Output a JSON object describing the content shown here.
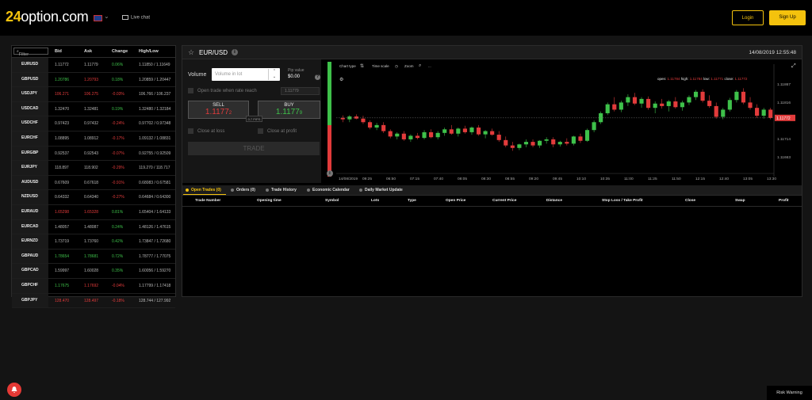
{
  "header": {
    "logo_prefix": "24",
    "logo_suffix": "option.com",
    "live_chat": "Live chat",
    "login": "Login",
    "signup": "Sign Up"
  },
  "instruments": {
    "filter_placeholder": "Filter",
    "columns": [
      "Bid",
      "Ask",
      "Change",
      "High/Low"
    ],
    "rows": [
      {
        "symbol": "EURUSD",
        "bid": "1.11772",
        "ask": "1.11779",
        "change": "0.06%",
        "highlow": "1.11850 / 1.11649",
        "bid_dir": "nt",
        "ask_dir": "nt",
        "chg_dir": "up"
      },
      {
        "symbol": "GBPUSD",
        "bid": "1.20786",
        "ask": "1.20793",
        "change": "0.18%",
        "highlow": "1.20859 / 1.20447",
        "bid_dir": "up",
        "ask_dir": "dn",
        "chg_dir": "up"
      },
      {
        "symbol": "USDJPY",
        "bid": "106.271",
        "ask": "106.275",
        "change": "-0.03%",
        "highlow": "106.766 / 106.237",
        "bid_dir": "dn",
        "ask_dir": "dn",
        "chg_dir": "dn"
      },
      {
        "symbol": "USDCAD",
        "bid": "1.32470",
        "ask": "1.32481",
        "change": "0.19%",
        "highlow": "1.32480 / 1.32184",
        "bid_dir": "nt",
        "ask_dir": "nt",
        "chg_dir": "up"
      },
      {
        "symbol": "USDCHF",
        "bid": "0.97423",
        "ask": "0.97432",
        "change": "-0.24%",
        "highlow": "0.97702 / 0.97348",
        "bid_dir": "nt",
        "ask_dir": "nt",
        "chg_dir": "dn"
      },
      {
        "symbol": "EURCHF",
        "bid": "1.08895",
        "ask": "1.08912",
        "change": "-0.17%",
        "highlow": "1.09132 / 1.08831",
        "bid_dir": "nt",
        "ask_dir": "nt",
        "chg_dir": "dn"
      },
      {
        "symbol": "EURGBP",
        "bid": "0.92537",
        "ask": "0.92543",
        "change": "-0.07%",
        "highlow": "0.92755 / 0.92509",
        "bid_dir": "nt",
        "ask_dir": "nt",
        "chg_dir": "dn"
      },
      {
        "symbol": "EURJPY",
        "bid": "118.897",
        "ask": "118.902",
        "change": "-0.29%",
        "highlow": "119.270 / 118.717",
        "bid_dir": "nt",
        "ask_dir": "nt",
        "chg_dir": "dn"
      },
      {
        "symbol": "AUDUSD",
        "bid": "0.67609",
        "ask": "0.67618",
        "change": "-0.91%",
        "highlow": "0.68083 / 0.67581",
        "bid_dir": "nt",
        "ask_dir": "nt",
        "chg_dir": "dn"
      },
      {
        "symbol": "NZDUSD",
        "bid": "0.64332",
        "ask": "0.64340",
        "change": "-0.27%",
        "highlow": "0.64684 / 0.64300",
        "bid_dir": "nt",
        "ask_dir": "nt",
        "chg_dir": "dn"
      },
      {
        "symbol": "EURAUD",
        "bid": "1.65298",
        "ask": "1.65328",
        "change": "0.81%",
        "highlow": "1.65404 / 1.64133",
        "bid_dir": "dn",
        "ask_dir": "dn",
        "chg_dir": "up"
      },
      {
        "symbol": "EURCAD",
        "bid": "1.48057",
        "ask": "1.48087",
        "change": "0.24%",
        "highlow": "1.48126 / 1.47615",
        "bid_dir": "nt",
        "ask_dir": "nt",
        "chg_dir": "up"
      },
      {
        "symbol": "EURNZD",
        "bid": "1.73719",
        "ask": "1.73760",
        "change": "0.42%",
        "highlow": "1.73847 / 1.72680",
        "bid_dir": "nt",
        "ask_dir": "nt",
        "chg_dir": "up"
      },
      {
        "symbol": "GBPAUD",
        "bid": "1.78654",
        "ask": "1.78681",
        "change": "0.72%",
        "highlow": "1.78777 / 1.77075",
        "bid_dir": "up",
        "ask_dir": "up",
        "chg_dir": "up"
      },
      {
        "symbol": "GBPCAD",
        "bid": "1.59997",
        "ask": "1.60028",
        "change": "0.35%",
        "highlow": "1.60056 / 1.59270",
        "bid_dir": "nt",
        "ask_dir": "nt",
        "chg_dir": "up"
      },
      {
        "symbol": "GBPCHF",
        "bid": "1.17675",
        "ask": "1.17692",
        "change": "-0.04%",
        "highlow": "1.17799 / 1.17418",
        "bid_dir": "up",
        "ask_dir": "dn",
        "chg_dir": "dn"
      },
      {
        "symbol": "GBPJPY",
        "bid": "128.470",
        "ask": "128.497",
        "change": "-0.18%",
        "highlow": "128.744 / 127.992",
        "bid_dir": "dn",
        "ask_dir": "dn",
        "chg_dir": "dn"
      }
    ]
  },
  "panel": {
    "symbol": "EUR/USD",
    "datetime": "14/08/2019 12:55:48",
    "volume_label": "Volume",
    "volume_placeholder": "Volume in lot",
    "pip_label": "Pip value",
    "pip_value": "$0.00",
    "open_trade_label": "Open trade when rate reach",
    "rate_value": "1.11779",
    "sell_label": "SELL",
    "sell_price": "1.1177",
    "sell_sub": "2",
    "buy_label": "BUY",
    "buy_price": "1.1177",
    "buy_sub": "9",
    "pips": "0.7 PIPS",
    "close_loss": "Close at loss",
    "close_profit": "Close at profit",
    "trade_button": "TRADE",
    "sentiment_buy": 0.55
  },
  "chart_toolbar": {
    "chart_type": "Chart type",
    "time_scale": "Time scale",
    "zoom": "Zoom",
    "more": "..."
  },
  "chart_data": {
    "type": "candlestick",
    "ohlc_labels": {
      "open": "open:",
      "high": "high:",
      "low": "low:",
      "close": "close:"
    },
    "ohlc_values": {
      "open": "1.11784",
      "high": "1.11784",
      "low": "1.11771",
      "close": "1.11772"
    },
    "current_price": "1.11772",
    "y_ticks": [
      "1.11867",
      "1.11816",
      "1.11714",
      "1.11663"
    ],
    "y_tick_values": [
      1.11867,
      1.11816,
      1.11714,
      1.11663
    ],
    "x_ticks": [
      "14/08/2019",
      "09:25",
      "06:50",
      "07:15",
      "07:40",
      "08:05",
      "08:30",
      "08:55",
      "09:20",
      "09:45",
      "10:10",
      "10:35",
      "11:00",
      "11:25",
      "11:50",
      "12:15",
      "12:40",
      "13:05",
      "13:30"
    ],
    "ylim": [
      1.1163,
      1.119
    ],
    "candles": [
      [
        1.11772,
        1.11779,
        1.1176,
        1.11768
      ],
      [
        1.11768,
        1.1178,
        1.1176,
        1.11776
      ],
      [
        1.11776,
        1.11782,
        1.11768,
        1.1177
      ],
      [
        1.1177,
        1.11778,
        1.11755,
        1.1176
      ],
      [
        1.1176,
        1.11765,
        1.1174,
        1.11745
      ],
      [
        1.11745,
        1.11758,
        1.11738,
        1.11752
      ],
      [
        1.11752,
        1.1176,
        1.1173,
        1.11735
      ],
      [
        1.11735,
        1.1174,
        1.11715,
        1.1172
      ],
      [
        1.1172,
        1.11732,
        1.11712,
        1.11728
      ],
      [
        1.11728,
        1.11735,
        1.11708,
        1.11712
      ],
      [
        1.11712,
        1.11726,
        1.11705,
        1.11722
      ],
      [
        1.11722,
        1.1173,
        1.11712,
        1.11716
      ],
      [
        1.11716,
        1.11738,
        1.11712,
        1.11732
      ],
      [
        1.11732,
        1.1174,
        1.11715,
        1.11718
      ],
      [
        1.11718,
        1.11735,
        1.11712,
        1.1173
      ],
      [
        1.1173,
        1.11745,
        1.11722,
        1.1174
      ],
      [
        1.1174,
        1.11752,
        1.11725,
        1.11728
      ],
      [
        1.11728,
        1.11745,
        1.1172,
        1.11742
      ],
      [
        1.11742,
        1.1175,
        1.11728,
        1.11732
      ],
      [
        1.11732,
        1.11748,
        1.11725,
        1.11745
      ],
      [
        1.11745,
        1.11752,
        1.11722,
        1.11726
      ],
      [
        1.11726,
        1.11738,
        1.11715,
        1.11735
      ],
      [
        1.11735,
        1.11742,
        1.11722,
        1.11725
      ],
      [
        1.11725,
        1.11735,
        1.11705,
        1.1171
      ],
      [
        1.1171,
        1.1172,
        1.1169,
        1.11695
      ],
      [
        1.11695,
        1.11705,
        1.1168,
        1.11688
      ],
      [
        1.11688,
        1.117,
        1.11682,
        1.11698
      ],
      [
        1.11698,
        1.11712,
        1.1169,
        1.11705
      ],
      [
        1.11705,
        1.11712,
        1.1169,
        1.11695
      ],
      [
        1.11695,
        1.1171,
        1.11688,
        1.11708
      ],
      [
        1.11708,
        1.11718,
        1.117,
        1.11712
      ],
      [
        1.11712,
        1.11718,
        1.1169,
        1.11698
      ],
      [
        1.11698,
        1.11708,
        1.11692,
        1.11705
      ],
      [
        1.11705,
        1.11715,
        1.11695,
        1.117
      ],
      [
        1.117,
        1.11722,
        1.11695,
        1.1172
      ],
      [
        1.1172,
        1.11728,
        1.11702,
        1.11708
      ],
      [
        1.11708,
        1.11742,
        1.11705,
        1.11738
      ],
      [
        1.11738,
        1.11765,
        1.11732,
        1.1176
      ],
      [
        1.1176,
        1.1179,
        1.11755,
        1.11785
      ],
      [
        1.11785,
        1.11815,
        1.1178,
        1.1181
      ],
      [
        1.1181,
        1.1183,
        1.1179,
        1.11795
      ],
      [
        1.11795,
        1.1182,
        1.11788,
        1.11815
      ],
      [
        1.11815,
        1.11838,
        1.11805,
        1.1183
      ],
      [
        1.1183,
        1.11842,
        1.11808,
        1.11812
      ],
      [
        1.11812,
        1.1183,
        1.118,
        1.11825
      ],
      [
        1.11825,
        1.11832,
        1.11795,
        1.118
      ],
      [
        1.118,
        1.11818,
        1.11785,
        1.11812
      ],
      [
        1.11812,
        1.11825,
        1.11798,
        1.11805
      ],
      [
        1.11805,
        1.11822,
        1.1179,
        1.11818
      ],
      [
        1.11818,
        1.1183,
        1.11798,
        1.11802
      ],
      [
        1.11802,
        1.1182,
        1.11792,
        1.11815
      ],
      [
        1.11815,
        1.11835,
        1.11808,
        1.1183
      ],
      [
        1.1183,
        1.1185,
        1.11822,
        1.11845
      ],
      [
        1.11845,
        1.11852,
        1.11815,
        1.1182
      ],
      [
        1.1182,
        1.11835,
        1.118,
        1.11805
      ],
      [
        1.11805,
        1.11815,
        1.1177,
        1.11775
      ],
      [
        1.11775,
        1.118,
        1.11768,
        1.11795
      ],
      [
        1.11795,
        1.11828,
        1.1179,
        1.11822
      ],
      [
        1.11822,
        1.1185,
        1.11815,
        1.11845
      ],
      [
        1.11845,
        1.11855,
        1.1181,
        1.11815
      ],
      [
        1.11815,
        1.1183,
        1.11795,
        1.118
      ],
      [
        1.118,
        1.1181,
        1.11772,
        1.11778
      ],
      [
        1.11778,
        1.118,
        1.1177,
        1.11795
      ],
      [
        1.11795,
        1.118,
        1.11768,
        1.11772
      ]
    ]
  },
  "bottom_tabs": [
    "Open Trades (0)",
    "Orders (0)",
    "Trade History",
    "Economic Calendar",
    "Daily Market Update"
  ],
  "table_columns": [
    "Trade Number",
    "Opening time",
    "Symbol",
    "Lots",
    "Type",
    "Open Price",
    "Current Price",
    "Distance",
    "Stop Loss / Take Profit",
    "Close",
    "Swap",
    "Profit"
  ],
  "footer": {
    "risk_warning": "Risk Warning"
  },
  "colors": {
    "accent": "#f4c20d",
    "up": "#3ec14a",
    "down": "#e23b3b"
  }
}
